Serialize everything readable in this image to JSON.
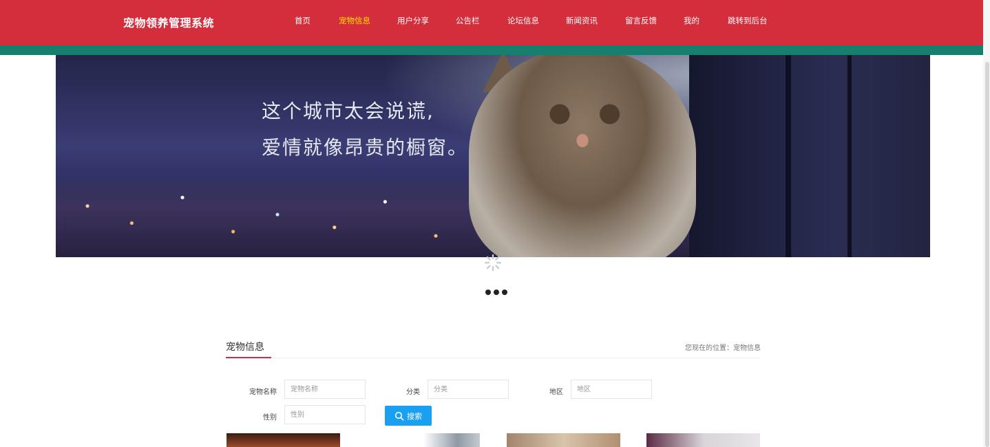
{
  "header": {
    "brand": "宠物领养管理系统",
    "nav": [
      {
        "label": "首页",
        "active": false
      },
      {
        "label": "宠物信息",
        "active": true
      },
      {
        "label": "用户分享",
        "active": false
      },
      {
        "label": "公告栏",
        "active": false
      },
      {
        "label": "论坛信息",
        "active": false
      },
      {
        "label": "新闻资讯",
        "active": false
      },
      {
        "label": "留言反馈",
        "active": false
      },
      {
        "label": "我的",
        "active": false
      },
      {
        "label": "跳转到后台",
        "active": false
      }
    ]
  },
  "banner": {
    "slogan_line1": "这个城市太会说谎,",
    "slogan_line2": "爱情就像昂贵的橱窗。"
  },
  "section": {
    "title": "宠物信息",
    "breadcrumb": "您现在的位置：宠物信息"
  },
  "search": {
    "name_label": "宠物名称",
    "name_placeholder": "宠物名称",
    "category_label": "分类",
    "category_placeholder": "分类",
    "region_label": "地区",
    "region_placeholder": "地区",
    "gender_label": "性别",
    "gender_placeholder": "性别",
    "button_label": "搜索"
  },
  "colors": {
    "header_bg": "#d42d3c",
    "accent_strip": "#16806f",
    "active_nav": "#ffe000",
    "search_button": "#1aa0f0"
  }
}
